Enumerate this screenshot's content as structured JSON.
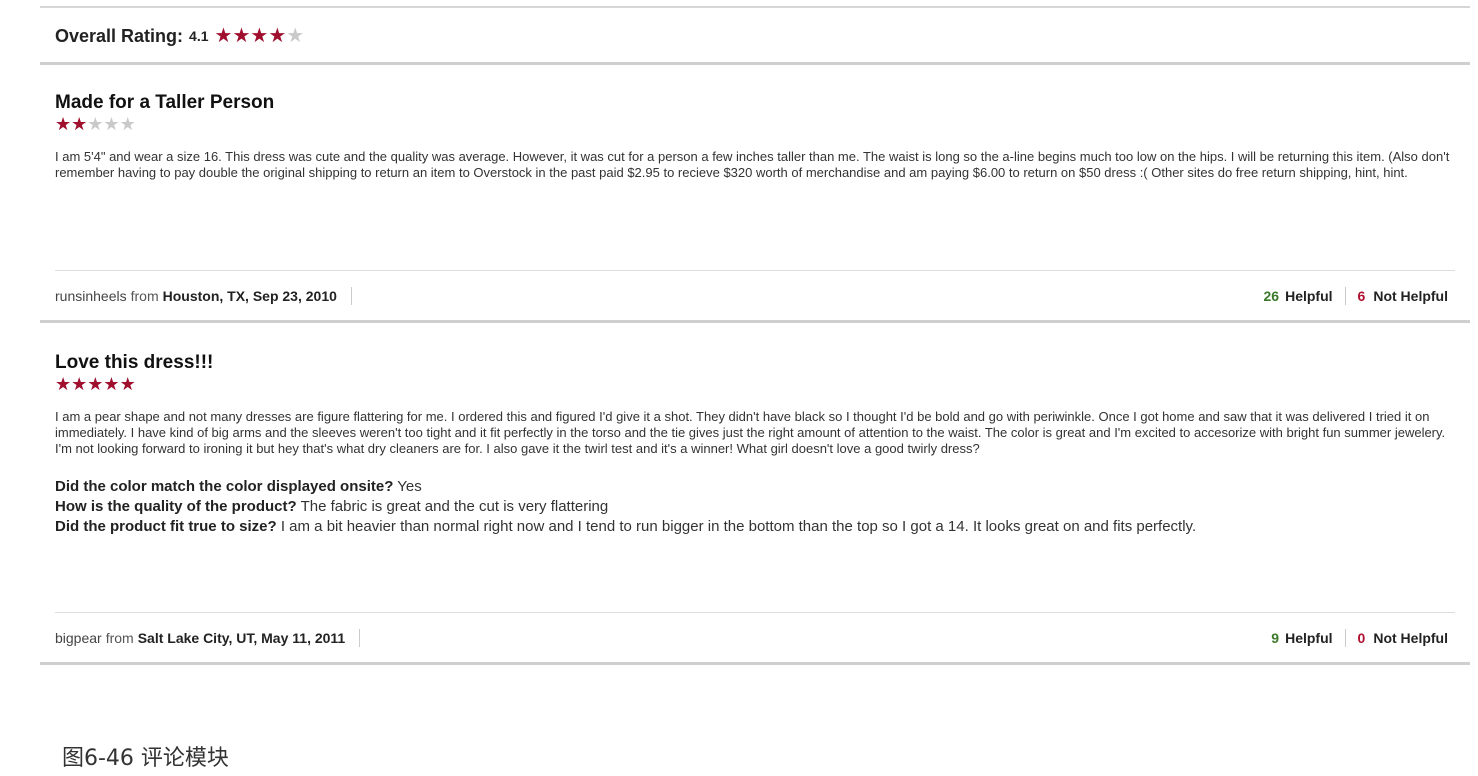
{
  "colors": {
    "star_filled": "#a0102e",
    "star_empty": "#c9c9c9",
    "helpful_count": "#3a7a2a",
    "not_helpful_count": "#b01030"
  },
  "overall": {
    "label": "Overall Rating:",
    "value": "4.1",
    "stars_filled": 4,
    "stars_total": 5
  },
  "reviews": [
    {
      "title": "Made for a Taller Person",
      "stars_filled": 2,
      "stars_total": 5,
      "body": "I am 5'4\" and wear a size 16. This dress was cute and the quality was average. However, it was cut for a person a few inches taller than me. The waist is long so the a-line begins much too low on the hips. I will be returning this item. (Also don't remember having to pay double the original shipping to return an item to Overstock in the past paid $2.95 to recieve $320 worth of merchandise and am paying $6.00 to return on $50 dress :( Other sites do free return shipping, hint, hint.",
      "author": "runsinheels",
      "from_word": "from",
      "location": "Houston, TX, Sep 23, 2010",
      "helpful_count": "26",
      "helpful_label": "Helpful",
      "not_helpful_count": "6",
      "not_helpful_label": "Not Helpful"
    },
    {
      "title": "Love this dress!!!",
      "stars_filled": 5,
      "stars_total": 5,
      "body": "I am a pear shape and not many dresses are figure flattering for me. I ordered this and figured I'd give it a shot. They didn't have black so I thought I'd be bold and go with periwinkle. Once I got home and saw that it was delivered I tried it on immediately. I have kind of big arms and the sleeves weren't too tight and it fit perfectly in the torso and the tie gives just the right amount of attention to the waist. The color is great and I'm excited to accesorize with bright fun summer jewelery. I'm not looking forward to ironing it but hey that's what dry cleaners are for. I also gave it the twirl test and it's a winner! What girl doesn't love a good twirly dress?",
      "qa": [
        {
          "q": "Did the color match the color displayed onsite?",
          "a": "Yes"
        },
        {
          "q": "How is the quality of the product?",
          "a": "The fabric is great and the cut is very flattering"
        },
        {
          "q": "Did the product fit true to size?",
          "a": "I am a bit heavier than normal right now and I tend to run bigger in the bottom than the top so I got a 14. It looks great on and fits perfectly."
        }
      ],
      "author": "bigpear",
      "from_word": "from",
      "location": "Salt Lake City, UT, May 11, 2011",
      "helpful_count": "9",
      "helpful_label": "Helpful",
      "not_helpful_count": "0",
      "not_helpful_label": "Not Helpful"
    }
  ],
  "caption": "图6-46 评论模块"
}
